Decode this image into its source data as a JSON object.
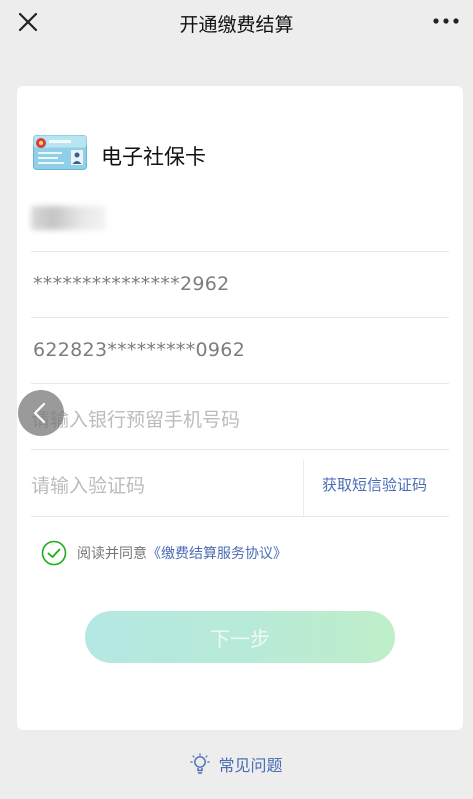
{
  "nav": {
    "title": "开通缴费结算"
  },
  "card": {
    "card_type_title": "电子社保卡",
    "id_masked": "***************2962",
    "bank_card_masked": "622823*********0962",
    "phone_placeholder": "请输入银行预留手机号码",
    "code_placeholder": "请输入验证码",
    "get_sms_label": "获取短信验证码",
    "agree_prefix": "阅读并同意",
    "agreement_link": "《缴费结算服务协议》",
    "next_label": "下一步"
  },
  "footer": {
    "faq_label": "常见问题"
  },
  "colors": {
    "accent_blue": "#4a6db5",
    "check_green": "#1aad19"
  }
}
